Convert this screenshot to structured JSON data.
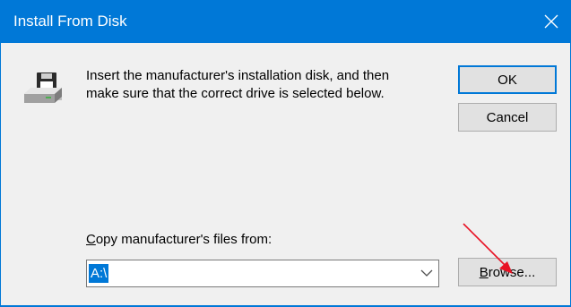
{
  "window": {
    "title": "Install From Disk"
  },
  "message": {
    "line1": "Insert the manufacturer's installation disk, and then",
    "line2": "make sure that the correct drive is selected below."
  },
  "buttons": {
    "ok": "OK",
    "cancel": "Cancel",
    "browse_prefix": "B",
    "browse_rest": "rowse..."
  },
  "copy_from": {
    "label_prefix": "C",
    "label_rest": "opy manufacturer's files from:",
    "value": "A:\\"
  },
  "icons": {
    "close": "close-icon",
    "disk": "floppy-disk-icon",
    "dropdown": "chevron-down-icon",
    "annotation": "red-arrow-icon"
  },
  "colors": {
    "titlebar": "#0078d7",
    "selection": "#0078d7",
    "annotation": "#e81123"
  }
}
